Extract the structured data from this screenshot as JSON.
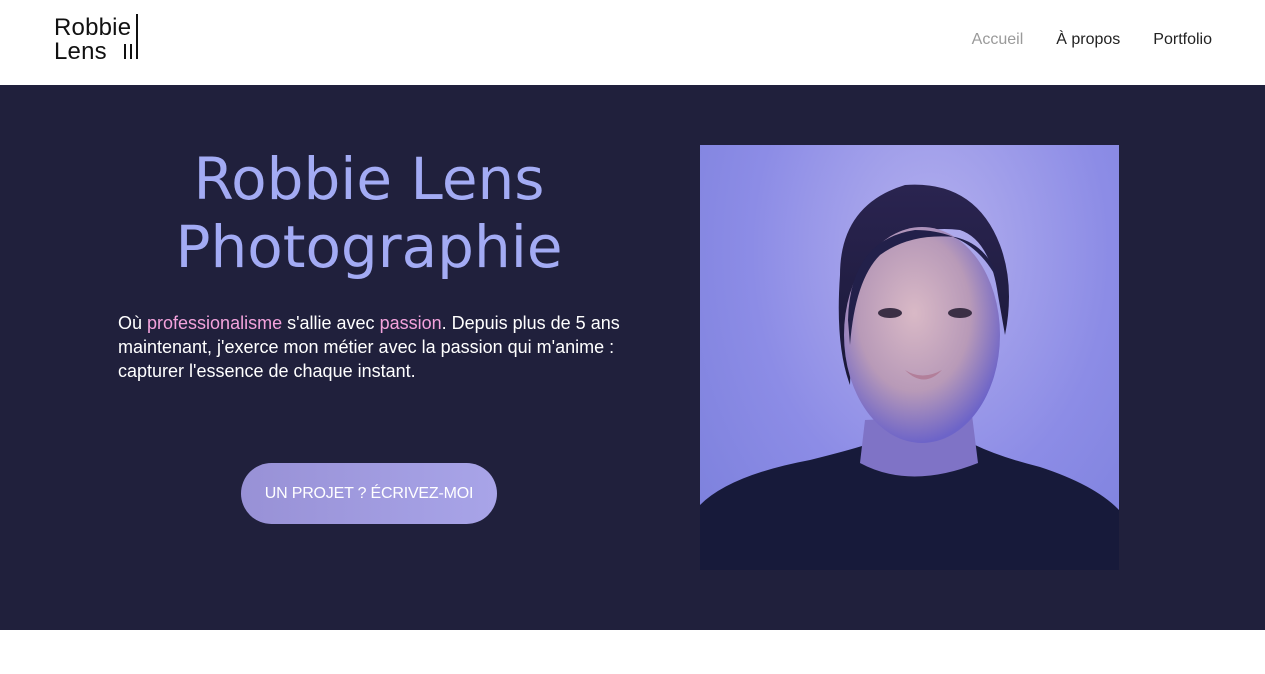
{
  "header": {
    "logo": {
      "line1": "Robbie",
      "line2": "Lens"
    },
    "nav": [
      {
        "label": "Accueil",
        "active": true
      },
      {
        "label": "À propos",
        "active": false
      },
      {
        "label": "Portfolio",
        "active": false
      }
    ]
  },
  "hero": {
    "title_line1": "Robbie Lens",
    "title_line2": "Photographie",
    "text": {
      "part1": "Où ",
      "highlight1": "professionalisme",
      "part2": " s'allie avec ",
      "highlight2": "passion",
      "part3": ". Depuis plus de 5 ans maintenant, j'exerce mon métier avec la passion qui m'anime : capturer l'essence de chaque instant."
    },
    "cta_label": "UN PROJET ? ÉCRIVEZ-MOI"
  },
  "colors": {
    "hero_bg": "#20203c",
    "title": "#a3abf4",
    "highlight": "#f3a2dc",
    "button": "#a09ce0"
  }
}
